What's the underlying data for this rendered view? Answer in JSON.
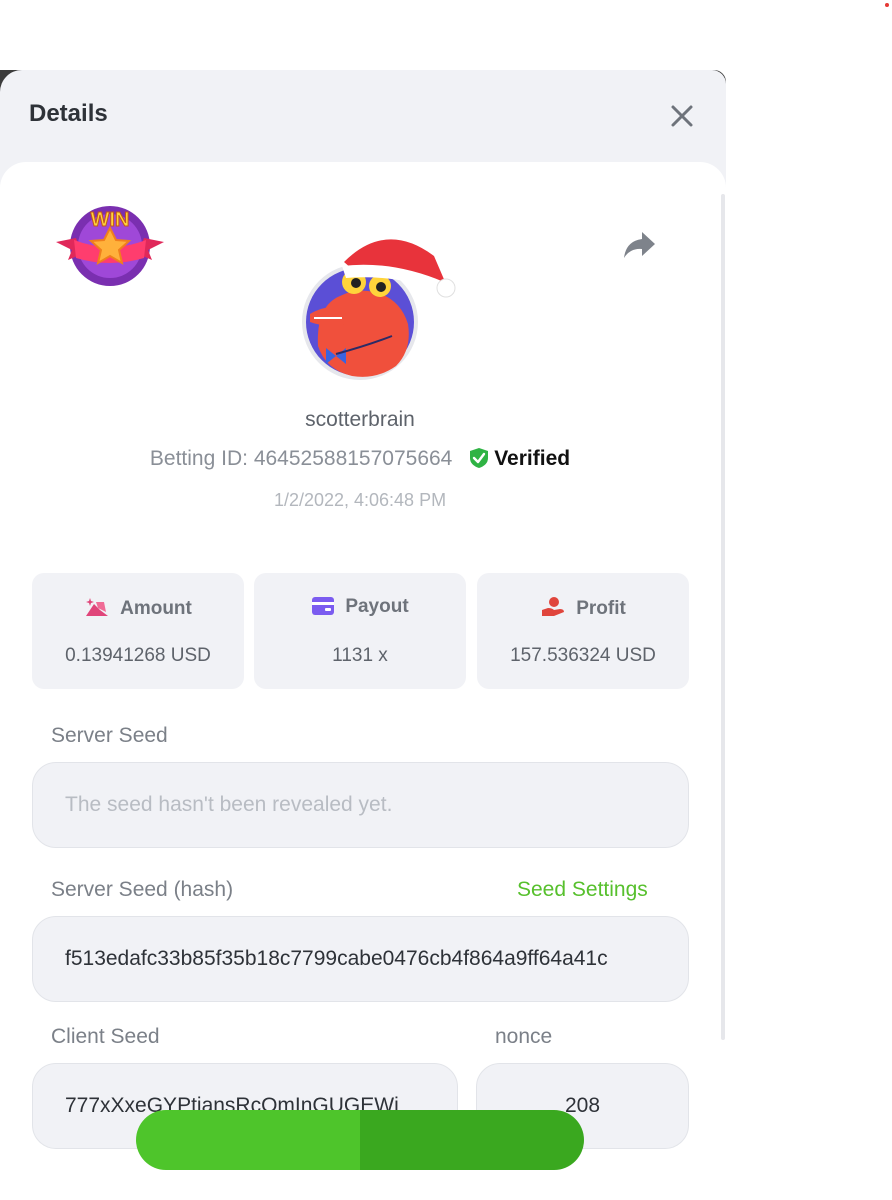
{
  "modal": {
    "title": "Details"
  },
  "player": {
    "username": "scotterbrain",
    "betting_id_label": "Betting ID:",
    "betting_id": "46452588157075664",
    "verified_label": "Verified",
    "timestamp": "1/2/2022, 4:06:48 PM",
    "badge_text": "WIN"
  },
  "stats": [
    {
      "label": "Amount",
      "value": "0.13941268 USD",
      "icon": "wallet-sparkle-icon"
    },
    {
      "label": "Payout",
      "value": "1131 x",
      "icon": "card-icon"
    },
    {
      "label": "Profit",
      "value": "157.536324 USD",
      "icon": "hand-coin-icon"
    }
  ],
  "seeds": {
    "server_seed_label": "Server Seed",
    "server_seed_placeholder": "The seed hasn't been revealed yet.",
    "server_seed_hash_label": "Server Seed (hash)",
    "seed_settings_label": "Seed Settings",
    "server_seed_hash": "f513edafc33b85f35b18c7799cabe0476cb4f864a9ff64a41c",
    "client_seed_label": "Client Seed",
    "client_seed": "777xXxeGYPtiansRcOmInGUGEWi",
    "nonce_label": "nonce",
    "nonce": "208"
  },
  "colors": {
    "accent_green": "#57c02d",
    "verified_green": "#2fb344",
    "amount_icon": "#e0457a",
    "payout_icon": "#7b5cf0",
    "profit_icon": "#e0453c"
  }
}
